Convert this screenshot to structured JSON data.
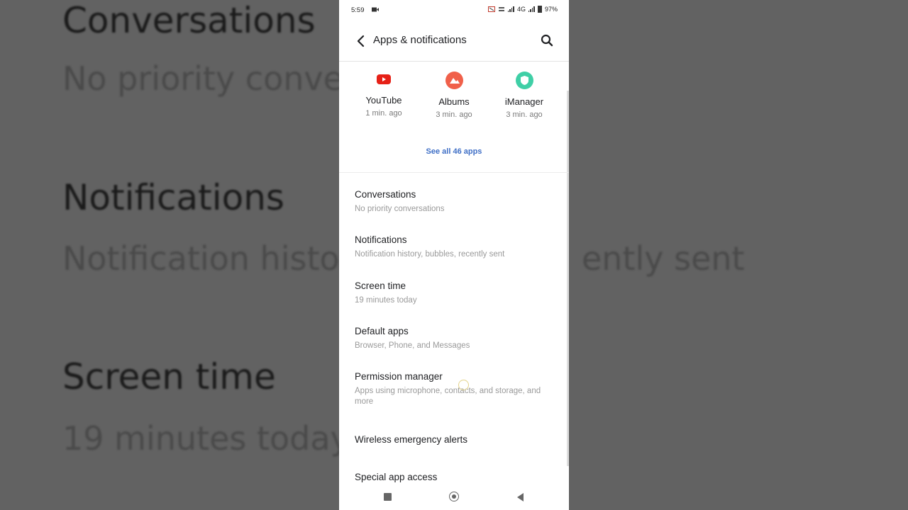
{
  "background": {
    "items": [
      {
        "title": "Conversations",
        "subtitle": "No priority conver"
      },
      {
        "title": "Notifications",
        "subtitle": "Notification histor",
        "subtitle_tail": "ently sent"
      },
      {
        "title": "Screen time",
        "subtitle": "19 minutes today"
      }
    ]
  },
  "status_bar": {
    "time": "5:59",
    "network": "4G",
    "battery": "97%"
  },
  "app_bar": {
    "title": "Apps & notifications"
  },
  "recent_apps": [
    {
      "name": "YouTube",
      "time": "1 min. ago",
      "icon": "youtube-icon",
      "color": "#e62117"
    },
    {
      "name": "Albums",
      "time": "3 min. ago",
      "icon": "albums-icon",
      "color": "#f0604a"
    },
    {
      "name": "iManager",
      "time": "3 min. ago",
      "icon": "imanager-icon",
      "color": "#3fcfa6"
    }
  ],
  "see_all": "See all 46 apps",
  "settings_list": [
    {
      "title": "Conversations",
      "subtitle": "No priority conversations"
    },
    {
      "title": "Notifications",
      "subtitle": "Notification history, bubbles, recently sent"
    },
    {
      "title": "Screen time",
      "subtitle": "19 minutes today"
    },
    {
      "title": "Default apps",
      "subtitle": "Browser, Phone, and Messages"
    },
    {
      "title": "Permission manager",
      "subtitle": "Apps using microphone, contacts, and storage, and more"
    },
    {
      "title": "Wireless emergency alerts",
      "subtitle": ""
    },
    {
      "title": "Special app access",
      "subtitle": ""
    }
  ],
  "colors": {
    "accent": "#3f6fc6",
    "text_primary": "#202124",
    "text_secondary": "#9a9a9a"
  }
}
